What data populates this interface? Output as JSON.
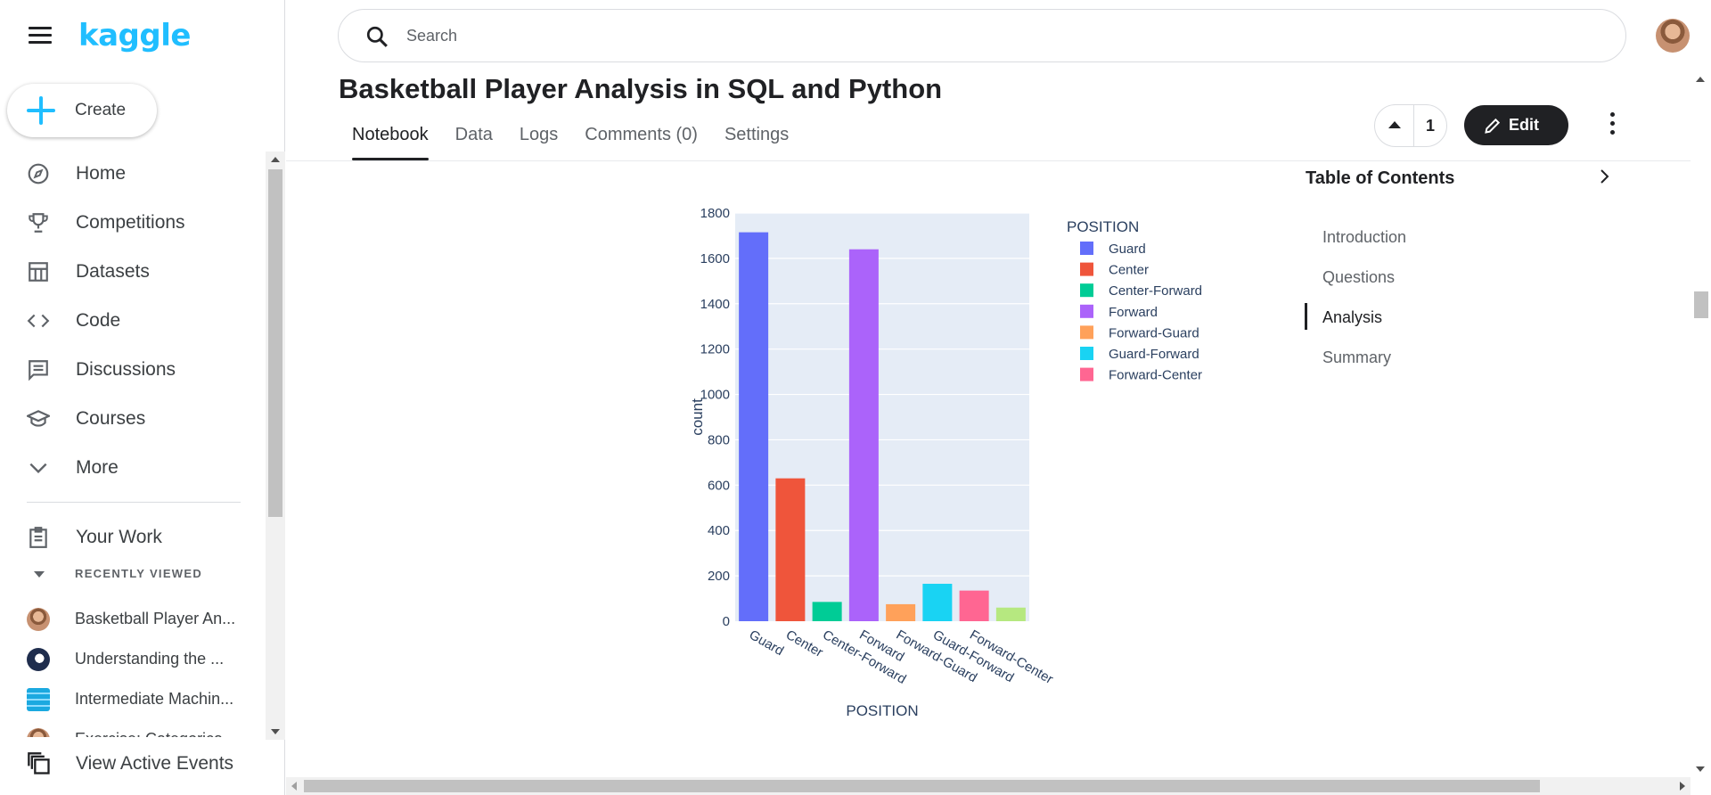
{
  "app": {
    "logo": "kaggle"
  },
  "sidebar": {
    "create_label": "Create",
    "items": [
      {
        "label": "Home",
        "icon": "compass-icon"
      },
      {
        "label": "Competitions",
        "icon": "trophy-icon"
      },
      {
        "label": "Datasets",
        "icon": "table-icon"
      },
      {
        "label": "Code",
        "icon": "code-icon"
      },
      {
        "label": "Discussions",
        "icon": "comment-icon"
      },
      {
        "label": "Courses",
        "icon": "school-icon"
      },
      {
        "label": "More",
        "icon": "chevron-down-icon"
      }
    ],
    "your_work": "Your Work",
    "recent_header": "RECENTLY VIEWED",
    "recent": [
      "Basketball Player An...",
      "Understanding the ...",
      "Intermediate Machin...",
      "Exercise: Categorica..."
    ],
    "active_events": "View Active Events"
  },
  "search": {
    "placeholder": "Search"
  },
  "notebook": {
    "title": "Basketball Player Analysis in SQL and Python",
    "tabs": [
      "Notebook",
      "Data",
      "Logs",
      "Comments (0)",
      "Settings"
    ],
    "active_tab": "Notebook",
    "vote_count": "1",
    "edit_label": "Edit"
  },
  "toc": {
    "title": "Table of Contents",
    "items": [
      "Introduction",
      "Questions",
      "Analysis",
      "Summary"
    ],
    "active": "Analysis"
  },
  "chart_data": {
    "type": "bar",
    "categories": [
      "Guard",
      "Center",
      "Center-Forward",
      "Forward",
      "Forward-Guard",
      "Guard-Forward",
      "Forward-Center",
      ""
    ],
    "values": [
      1715,
      630,
      85,
      1640,
      75,
      165,
      135,
      60
    ],
    "colors": [
      "#636efa",
      "#ef553b",
      "#00cc96",
      "#ab63fa",
      "#ffa15a",
      "#19d3f3",
      "#ff6692",
      "#b6e880"
    ],
    "xlabel": "POSITION",
    "ylabel": "count",
    "ylim": [
      0,
      1800
    ],
    "yticks": [
      0,
      200,
      400,
      600,
      800,
      1000,
      1200,
      1400,
      1600,
      1800
    ],
    "legend_title": "POSITION",
    "legend": [
      {
        "name": "Guard",
        "color": "#636efa"
      },
      {
        "name": "Center",
        "color": "#ef553b"
      },
      {
        "name": "Center-Forward",
        "color": "#00cc96"
      },
      {
        "name": "Forward",
        "color": "#ab63fa"
      },
      {
        "name": "Forward-Guard",
        "color": "#ffa15a"
      },
      {
        "name": "Guard-Forward",
        "color": "#19d3f3"
      },
      {
        "name": "Forward-Center",
        "color": "#ff6692"
      }
    ],
    "legend_position": "right",
    "plot_background": "#e5ecf6",
    "grid": true
  }
}
